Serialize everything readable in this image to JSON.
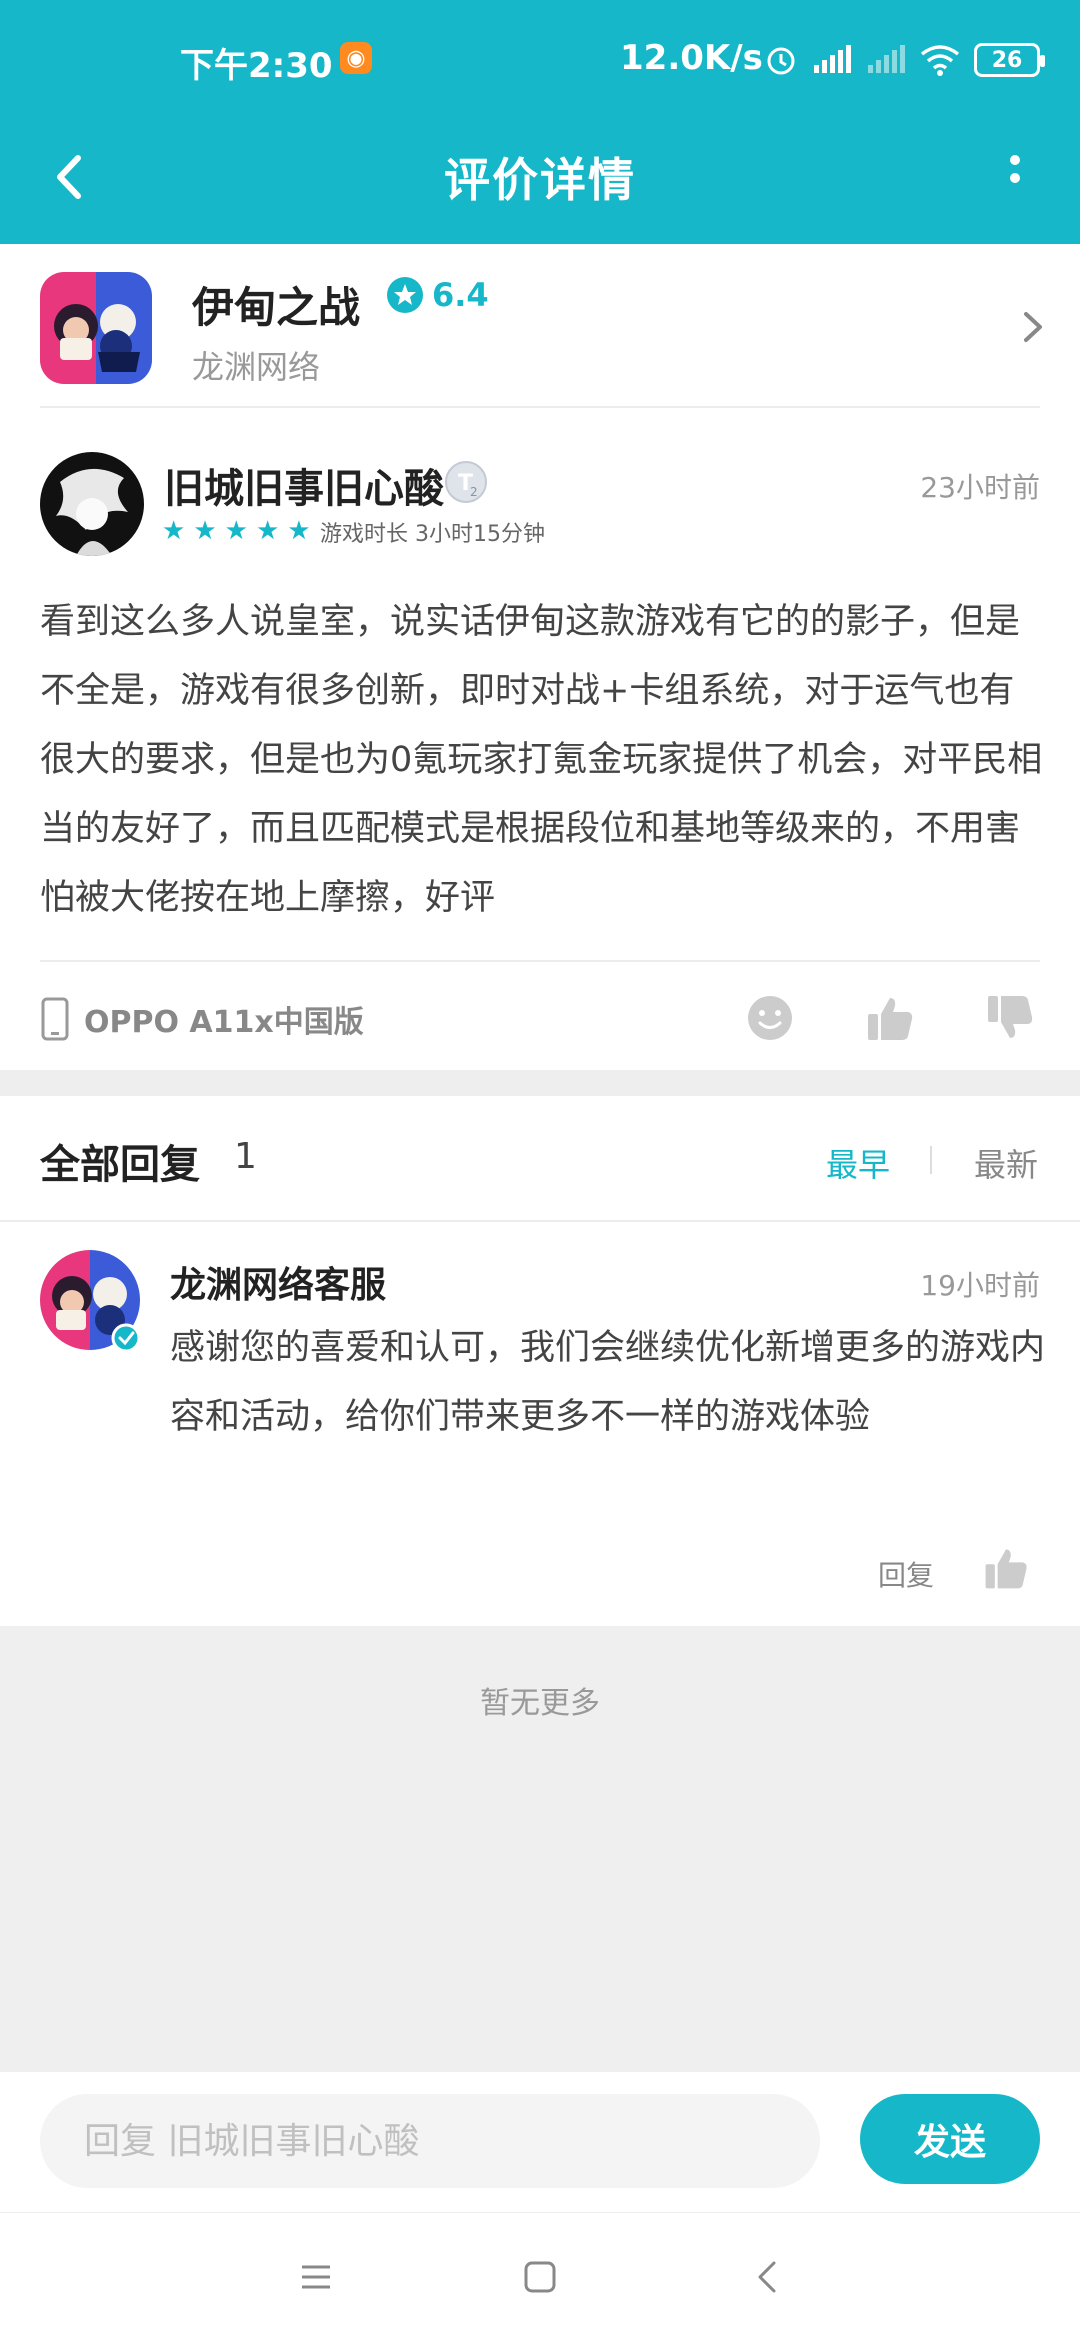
{
  "status_bar": {
    "time": "下午2:30",
    "net_speed": "12.0K/s",
    "battery": "26",
    "icons": [
      "uc-browser-icon",
      "alarm-icon",
      "signal-icon",
      "signal-weak-icon",
      "wifi-icon",
      "battery-icon"
    ]
  },
  "nav": {
    "title": "评价详情",
    "back_icon": "back-arrow-icon",
    "more_icon": "more-vertical-icon"
  },
  "game": {
    "name": "伊甸之战",
    "score": "6.4",
    "developer": "龙渊网络",
    "icon": "game-logo"
  },
  "review": {
    "user": "旧城旧事旧心酸",
    "time": "23小时前",
    "stars": 5,
    "playtime": "游戏时长 3小时15分钟",
    "text": "看到这么多人说皇室，说实话伊甸这款游戏有它的的影子，但是不全是，游戏有很多创新，即时对战+卡组系统，对于运气也有很大的要求，但是也为0氪玩家打氪金玩家提供了机会，对平民相当的友好了，而且匹配模式是根据段位和基地等级来的，不用害怕被大佬按在地上摩擦，好评",
    "device": "OPPO A11x中国版"
  },
  "replies": {
    "title": "全部回复",
    "count": "1",
    "sort_early": "最早",
    "sort_new": "最新",
    "items": [
      {
        "user": "龙渊网络客服",
        "time": "19小时前",
        "text": "感谢您的喜爱和认可，我们会继续优化新增更多的游戏内容和活动，给你们带来更多不一样的游戏体验",
        "reply_label": "回复"
      }
    ],
    "no_more": "暂无更多"
  },
  "input": {
    "placeholder": "回复 旧城旧事旧心酸",
    "send_label": "发送"
  },
  "colors": {
    "accent": "#16b7c8",
    "background": "#efefef"
  }
}
